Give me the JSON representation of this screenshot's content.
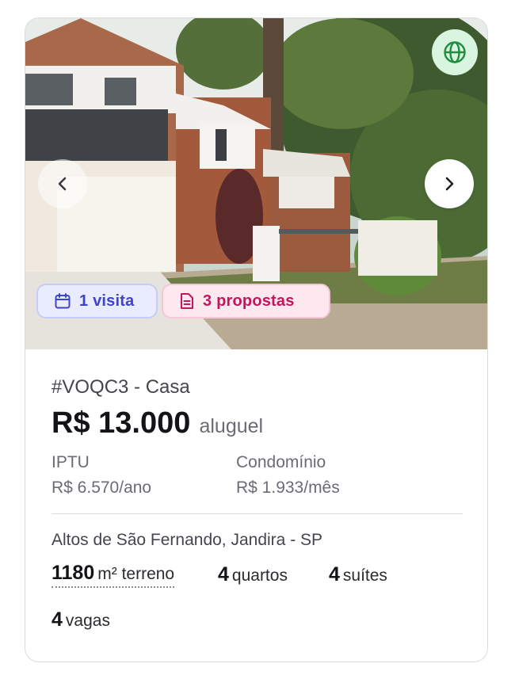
{
  "listing": {
    "code_type": "#VOQC3 - Casa",
    "price": "R$ 13.000",
    "price_type": "aluguel",
    "iptu_label": "IPTU",
    "iptu_value": "R$ 6.570/ano",
    "condo_label": "Condomínio",
    "condo_value": "R$ 1.933/mês",
    "address": "Altos de São Fernando, Jandira - SP",
    "area_value": "1180",
    "area_unit": "m² terreno",
    "bedrooms_value": "4",
    "bedrooms_unit": "quartos",
    "suites_value": "4",
    "suites_unit": "suítes",
    "parking_value": "4",
    "parking_unit": "vagas"
  },
  "badges": {
    "visits": "1 visita",
    "proposals": "3 propostas"
  },
  "icons": {
    "globe": "globe-icon",
    "prev": "chevron-left-icon",
    "next": "chevron-right-icon",
    "calendar": "calendar-icon",
    "document": "document-icon"
  },
  "colors": {
    "visits_accent": "#3d44c9",
    "proposals_accent": "#c2185b",
    "globe_accent": "#1e8e3e"
  }
}
